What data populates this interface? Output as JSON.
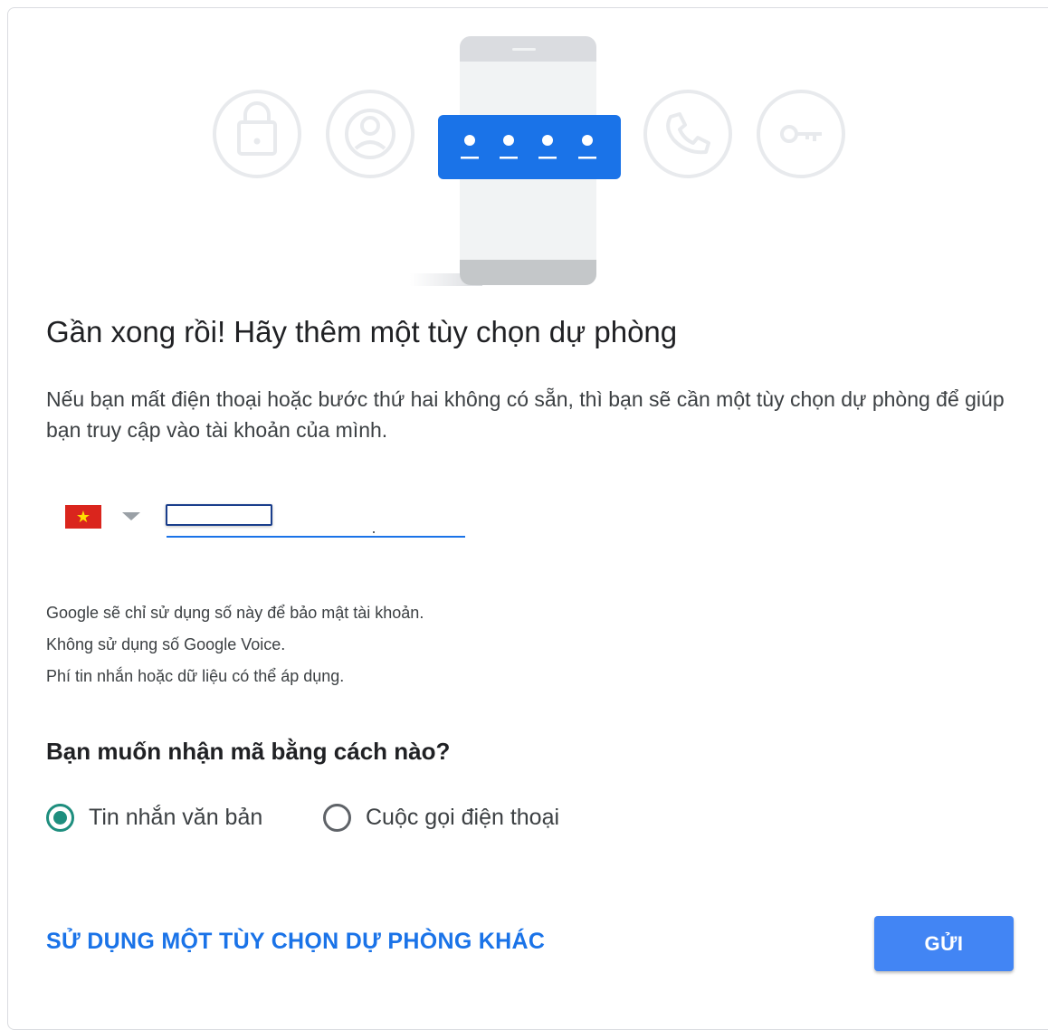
{
  "title": "Gần xong rồi! Hãy thêm một tùy chọn dự phòng",
  "description": "Nếu bạn mất điện thoại hoặc bước thứ hai không có sẵn, thì bạn sẽ cần một tùy chọn dự phòng để giúp bạn truy cập vào tài khoản của mình.",
  "phone": {
    "country_flag_icon": "vietnam-flag-icon",
    "flag_star": "★",
    "value": "",
    "placeholder": ""
  },
  "notes": [
    "Google sẽ chỉ sử dụng số này để bảo mật tài khoản.",
    "Không sử dụng số Google Voice.",
    "Phí tin nhắn hoặc dữ liệu có thể áp dụng."
  ],
  "question": "Bạn muốn nhận mã bằng cách nào?",
  "options": [
    {
      "label": "Tin nhắn văn bản",
      "selected": true
    },
    {
      "label": "Cuộc gọi điện thoại",
      "selected": false
    }
  ],
  "alt_link": "SỬ DỤNG MỘT TÙY CHỌN DỰ PHÒNG KHÁC",
  "send_button": "GỬI",
  "illustration_icons": [
    "lock-icon",
    "account-icon",
    "password-dots-icon",
    "phone-call-icon",
    "key-icon"
  ],
  "colors": {
    "accent_blue": "#1a73e8",
    "button_blue": "#4285f4",
    "radio_green": "#1e8e7e",
    "flag_red": "#da251d",
    "flag_star": "#ffde00"
  }
}
